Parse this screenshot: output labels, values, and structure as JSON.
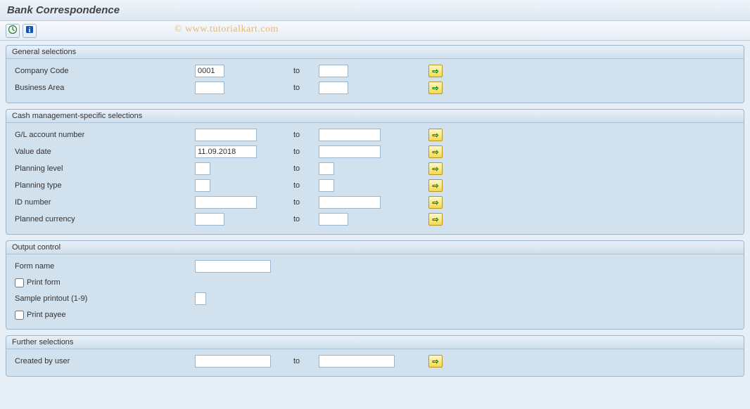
{
  "title": "Bank Correspondence",
  "watermark": "© www.tutorialkart.com",
  "groups": {
    "general": {
      "title": "General selections",
      "company_code": {
        "label": "Company Code",
        "from": "0001",
        "to_label": "to",
        "to": ""
      },
      "business_area": {
        "label": "Business Area",
        "from": "",
        "to_label": "to",
        "to": ""
      }
    },
    "cash": {
      "title": "Cash management-specific selections",
      "gl_account": {
        "label": "G/L account number",
        "from": "",
        "to_label": "to",
        "to": ""
      },
      "value_date": {
        "label": "Value date",
        "from": "11.09.2018",
        "to_label": "to",
        "to": ""
      },
      "planning_level": {
        "label": "Planning level",
        "from": "",
        "to_label": "to",
        "to": ""
      },
      "planning_type": {
        "label": "Planning type",
        "from": "",
        "to_label": "to",
        "to": ""
      },
      "id_number": {
        "label": "ID number",
        "from": "",
        "to_label": "to",
        "to": ""
      },
      "planned_currency": {
        "label": "Planned currency",
        "from": "",
        "to_label": "to",
        "to": ""
      }
    },
    "output": {
      "title": "Output control",
      "form_name": {
        "label": "Form name",
        "value": ""
      },
      "print_form": {
        "label": "Print form"
      },
      "sample_printout": {
        "label": "Sample printout (1-9)",
        "value": ""
      },
      "print_payee": {
        "label": "Print payee"
      }
    },
    "further": {
      "title": "Further selections",
      "created_by": {
        "label": "Created by user",
        "from": "",
        "to_label": "to",
        "to": ""
      }
    }
  }
}
